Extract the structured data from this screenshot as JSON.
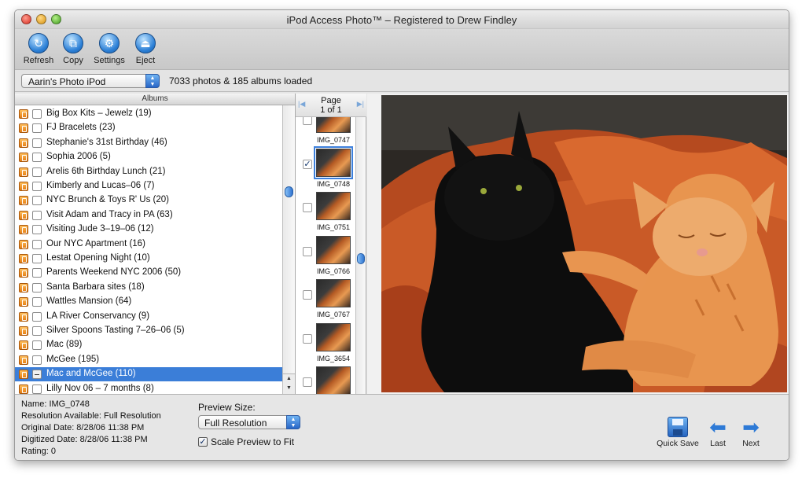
{
  "window": {
    "title": "iPod Access Photo™ – Registered to Drew Findley"
  },
  "toolbar": {
    "refresh": {
      "label": "Refresh",
      "icon": "refresh-icon"
    },
    "copy": {
      "label": "Copy",
      "icon": "copy-icon"
    },
    "settings": {
      "label": "Settings",
      "icon": "settings-icon"
    },
    "eject": {
      "label": "Eject",
      "icon": "eject-icon"
    }
  },
  "source": {
    "device": "Aarin's Photo iPod",
    "status": "7033 photos & 185 albums loaded"
  },
  "albums": {
    "header": "Albums",
    "items": [
      {
        "name": "Big Box Kits – Jewelz (19)",
        "selected": false
      },
      {
        "name": "FJ Bracelets (23)",
        "selected": false
      },
      {
        "name": "Stephanie's 31st Birthday (46)",
        "selected": false
      },
      {
        "name": "Sophia 2006 (5)",
        "selected": false
      },
      {
        "name": "Arelis 6th Birthday Lunch (21)",
        "selected": false
      },
      {
        "name": "Kimberly and Lucas–06 (7)",
        "selected": false
      },
      {
        "name": "NYC Brunch & Toys R' Us (20)",
        "selected": false
      },
      {
        "name": "Visit Adam and Tracy in PA (63)",
        "selected": false
      },
      {
        "name": "Visiting Jude 3–19–06 (12)",
        "selected": false
      },
      {
        "name": "Our NYC Apartment (16)",
        "selected": false
      },
      {
        "name": "Lestat Opening Night (10)",
        "selected": false
      },
      {
        "name": "Parents Weekend NYC 2006 (50)",
        "selected": false
      },
      {
        "name": "Santa Barbara sites (18)",
        "selected": false
      },
      {
        "name": "Wattles Mansion (64)",
        "selected": false
      },
      {
        "name": "LA River Conservancy (9)",
        "selected": false
      },
      {
        "name": "Silver Spoons Tasting 7–26–06 (5)",
        "selected": false
      },
      {
        "name": "Mac (89)",
        "selected": false
      },
      {
        "name": "McGee (195)",
        "selected": false
      },
      {
        "name": "Mac and McGee (110)",
        "selected": true
      },
      {
        "name": "Lilly Nov 06 – 7 months (8)",
        "selected": false
      }
    ]
  },
  "pager": {
    "label": "Page",
    "sub": "1 of 1"
  },
  "thumbnails": [
    {
      "name": "IMG_0747",
      "checked": false,
      "selected": false
    },
    {
      "name": "IMG_0748",
      "checked": true,
      "selected": true
    },
    {
      "name": "IMG_0751",
      "checked": false,
      "selected": false
    },
    {
      "name": "IMG_0766",
      "checked": false,
      "selected": false
    },
    {
      "name": "IMG_0767",
      "checked": false,
      "selected": false
    },
    {
      "name": "IMG_3654",
      "checked": false,
      "selected": false
    },
    {
      "name": "",
      "checked": false,
      "selected": false
    }
  ],
  "info": {
    "name": "Name: IMG_0748",
    "resolution": "Resolution Available: Full Resolution",
    "original_date": "Original Date: 8/28/06 11:38 PM",
    "digitized_date": "Digitized Date: 8/28/06 11:38 PM",
    "rating": "Rating: 0"
  },
  "preview_size": {
    "label": "Preview Size:",
    "value": "Full Resolution",
    "scale_label": "Scale Preview to Fit",
    "scale_checked": true
  },
  "nav": {
    "quick_save": "Quick Save",
    "last": "Last",
    "next": "Next"
  },
  "check_mark": "✓",
  "colors": {
    "selection": "#3b7ed8",
    "accent": "#2e7ad6"
  }
}
